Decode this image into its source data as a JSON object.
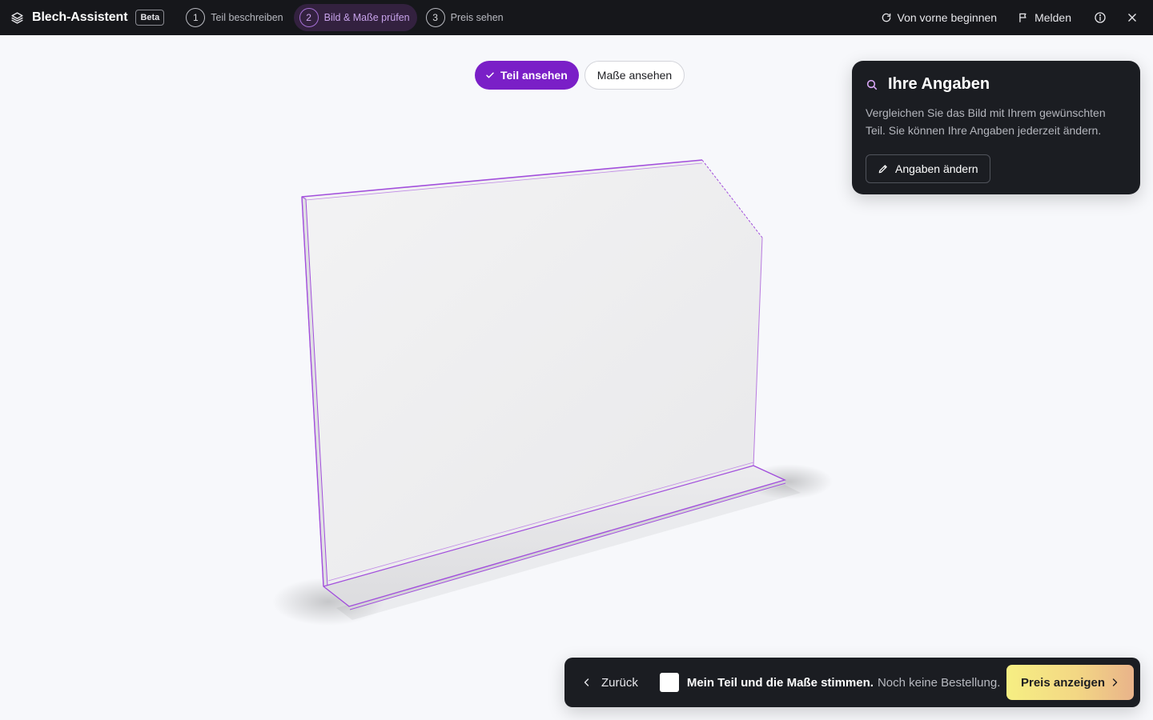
{
  "app": {
    "title": "Blech-Assistent",
    "badge": "Beta"
  },
  "steps": [
    {
      "number": "1",
      "label": "Teil beschreiben",
      "active": false
    },
    {
      "number": "2",
      "label": "Bild & Maße prüfen",
      "active": true
    },
    {
      "number": "3",
      "label": "Preis sehen",
      "active": false
    }
  ],
  "top_actions": {
    "restart_label": "Von vorne beginnen",
    "report_label": "Melden"
  },
  "view_toggle": {
    "part_label": "Teil ansehen",
    "dimensions_label": "Maße ansehen",
    "selected": "Teil ansehen"
  },
  "info_card": {
    "title": "Ihre Angaben",
    "text": "Vergleichen Sie das Bild mit Ihrem gewünschten Teil. Sie können Ihre Angaben jederzeit ändern.",
    "edit_label": "Angaben ändern"
  },
  "bottom_bar": {
    "back_label": "Zurück",
    "confirm_strong": "Mein Teil und die Maße stimmen.",
    "confirm_note": "Noch keine Bestellung.",
    "confirm_checked": false,
    "price_label": "Preis anzeigen"
  },
  "colors": {
    "accent": "#7a1fc7",
    "topbar_bg": "#16171b",
    "card_bg": "#1b1d22",
    "part_outline": "#a24fdc",
    "cta_gradient_start": "#f6ef83",
    "cta_gradient_end": "#e9b38a"
  },
  "icons": {
    "brand": "layers-icon",
    "restart": "refresh-icon",
    "report": "flag-icon",
    "info": "info-icon",
    "close": "close-icon",
    "check": "check-icon",
    "search": "search-icon",
    "edit": "pencil-icon",
    "back": "chevron-left-icon",
    "next": "chevron-right-icon"
  }
}
